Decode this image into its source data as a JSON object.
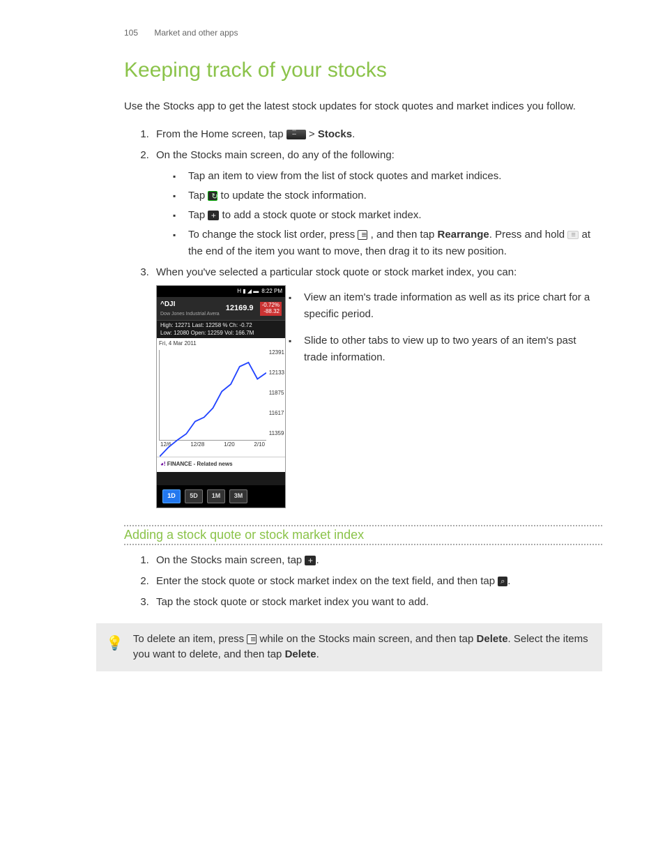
{
  "header": {
    "page_number": "105",
    "section": "Market and other apps"
  },
  "title": "Keeping track of your stocks",
  "intro": "Use the Stocks app to get the latest stock updates for stock quotes and market indices you follow.",
  "steps": {
    "s1_a": "From the Home screen, tap ",
    "s1_b": " > ",
    "s1_c": "Stocks",
    "s1_d": ".",
    "s2": "On the Stocks main screen, do any of the following:",
    "s2_items": {
      "a": "Tap an item to view from the list of stock quotes and market indices.",
      "b_a": "Tap ",
      "b_b": " to update the stock information.",
      "c_a": "Tap ",
      "c_b": " to add a stock quote or stock market index.",
      "d_a": "To change the stock list order, press ",
      "d_b": " , and then tap ",
      "d_c": "Rearrange",
      "d_d": ". Press and hold ",
      "d_e": " at the end of the item you want to move, then drag it to its new position."
    },
    "s3": "When you've selected a particular stock quote or stock market index, you can:",
    "s3_items": {
      "a": "View an item's trade information as well as its price chart for a specific period.",
      "b": "Slide to other tabs to view up to two years of an item's past trade information."
    }
  },
  "phone": {
    "status_time": "8:22 PM",
    "symbol": "^DJI",
    "symbol_name": "Dow Jones Industrial Avera",
    "price": "12169.9",
    "change_pct": "-0.72%",
    "change_abs": "-88.32",
    "stats_line1": "High: 12271   Last: 12258   % Ch: -0.72",
    "stats_line2": "Low: 12080   Open: 12259   Vol:   166.7M",
    "chart_date": "Fri, 4 Mar 2011",
    "news_label": "FINANCE - Related news",
    "tabs": [
      "1D",
      "5D",
      "1M",
      "3M"
    ],
    "active_tab": "1D"
  },
  "chart_data": {
    "type": "line",
    "title": "",
    "xlabel": "",
    "ylabel": "",
    "x_ticks": [
      "12/6",
      "12/28",
      "1/20",
      "2/10"
    ],
    "y_ticks": [
      "12391",
      "12133",
      "11875",
      "11617",
      "11359"
    ],
    "ylim": [
      11359,
      12391
    ],
    "series": [
      {
        "name": "^DJI",
        "x": [
          "12/6",
          "12/13",
          "12/20",
          "12/28",
          "1/4",
          "1/11",
          "1/20",
          "1/27",
          "2/3",
          "2/10",
          "2/17",
          "2/24",
          "3/4"
        ],
        "values": [
          11360,
          11450,
          11520,
          11580,
          11700,
          11740,
          11830,
          11990,
          12060,
          12230,
          12270,
          12110,
          12170
        ]
      }
    ]
  },
  "subsection": {
    "title": "Adding a stock quote or stock market index",
    "s1_a": "On the Stocks main screen, tap ",
    "s1_b": ".",
    "s2_a": "Enter the stock quote or stock market index on the text field, and then tap ",
    "s2_b": ".",
    "s3": "Tap the stock quote or stock market index you want to add."
  },
  "tip": {
    "a": "To delete an item, press ",
    "b": " while on the Stocks main screen, and then tap ",
    "c": "Delete",
    "d": ". Select the items you want to delete, and then tap ",
    "e": "Delete",
    "f": "."
  }
}
